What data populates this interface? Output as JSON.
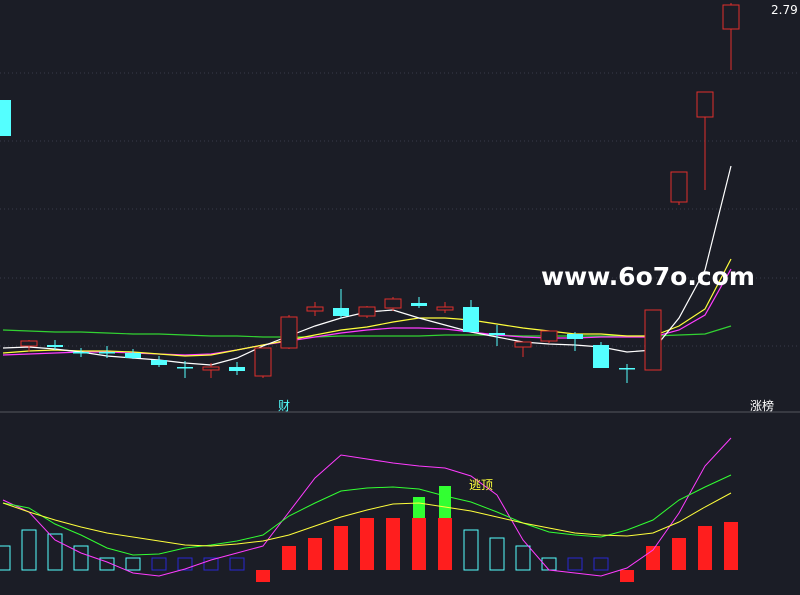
{
  "watermark": "www.6o7o.com",
  "colors": {
    "background": "#1b1d26",
    "grid": "#3a3c4a",
    "up": "#e0302c",
    "down": "#54ffff",
    "ma5": "#ffffff",
    "ma10": "#ffff3c",
    "ma20": "#ff3cff",
    "ma60": "#32d232",
    "bar_red": "#ff1e1e",
    "bar_green": "#32ff32",
    "bar_cyan": "#54ffff",
    "bar_blue": "#2828d2",
    "ind_magenta": "#ff3cff",
    "ind_green": "#32ff32",
    "ind_yellow": "#ffff3c"
  },
  "annotations": {
    "price_max": "2.79",
    "cai_label": "财",
    "zhangting_label": "涨榜",
    "taoding_label": "逃顶"
  },
  "chart_data": {
    "type": "candlestick",
    "candles": [
      {
        "o": 100,
        "h": 100,
        "l": 135,
        "c": 136
      },
      {
        "o": 346,
        "h": 340,
        "l": 352,
        "c": 341
      },
      {
        "o": 345,
        "h": 340,
        "l": 350,
        "c": 347
      },
      {
        "o": 352,
        "h": 348,
        "l": 357,
        "c": 352
      },
      {
        "o": 352,
        "h": 346,
        "l": 358,
        "c": 352
      },
      {
        "o": 353,
        "h": 349,
        "l": 359,
        "c": 358
      },
      {
        "o": 360,
        "h": 356,
        "l": 367,
        "c": 365
      },
      {
        "o": 367,
        "h": 361,
        "l": 378,
        "c": 368
      },
      {
        "o": 370,
        "h": 363,
        "l": 378,
        "c": 367
      },
      {
        "o": 367,
        "h": 362,
        "l": 375,
        "c": 371
      },
      {
        "o": 376,
        "h": 362,
        "l": 378,
        "c": 348
      },
      {
        "o": 348,
        "h": 315,
        "l": 349,
        "c": 317
      },
      {
        "o": 311,
        "h": 302,
        "l": 316,
        "c": 307
      },
      {
        "o": 308,
        "h": 289,
        "l": 318,
        "c": 316
      },
      {
        "o": 316,
        "h": 306,
        "l": 318,
        "c": 307
      },
      {
        "o": 308,
        "h": 297,
        "l": 311,
        "c": 299
      },
      {
        "o": 303,
        "h": 297,
        "l": 308,
        "c": 306
      },
      {
        "o": 310,
        "h": 302,
        "l": 313,
        "c": 307
      },
      {
        "o": 307,
        "h": 300,
        "l": 332,
        "c": 332
      },
      {
        "o": 333,
        "h": 325,
        "l": 346,
        "c": 335
      },
      {
        "o": 347,
        "h": 342,
        "l": 357,
        "c": 342
      },
      {
        "o": 341,
        "h": 331,
        "l": 343,
        "c": 331
      },
      {
        "o": 334,
        "h": 332,
        "l": 351,
        "c": 339
      },
      {
        "o": 345,
        "h": 342,
        "l": 368,
        "c": 368
      },
      {
        "o": 368,
        "h": 364,
        "l": 383,
        "c": 369
      },
      {
        "o": 370,
        "h": 310,
        "l": 370,
        "c": 310
      },
      {
        "o": 202,
        "h": 190,
        "l": 205,
        "c": 172
      },
      {
        "o": 117,
        "h": 92,
        "l": 190,
        "c": 92
      },
      {
        "o": 29,
        "h": 3,
        "l": 70,
        "c": 5
      }
    ],
    "ma5": [
      348,
      347,
      349,
      352,
      356,
      358,
      360,
      363,
      365,
      358,
      346,
      336,
      326,
      318,
      312,
      310,
      318,
      325,
      332,
      337,
      342,
      344,
      345,
      347,
      352,
      350,
      318,
      270,
      166
    ],
    "ma10": [
      353,
      351,
      350,
      351,
      351,
      352,
      354,
      356,
      355,
      350,
      345,
      340,
      335,
      330,
      327,
      322,
      318,
      318,
      320,
      324,
      328,
      331,
      334,
      334,
      336,
      336,
      326,
      309,
      259
    ],
    "ma20": [
      355,
      354,
      353,
      352,
      352,
      353,
      354,
      355,
      354,
      350,
      345,
      341,
      337,
      333,
      330,
      328,
      328,
      329,
      332,
      335,
      337,
      338,
      338,
      337,
      337,
      337,
      330,
      315,
      269
    ],
    "ma60": [
      330,
      331,
      332,
      332,
      333,
      334,
      334,
      335,
      336,
      336,
      337,
      337,
      337,
      336,
      336,
      336,
      336,
      335,
      335,
      335,
      336,
      336,
      336,
      336,
      336,
      336,
      335,
      334,
      326
    ],
    "indicator": {
      "bars": [
        {
          "v": 0,
          "c": "#54ffff",
          "h": 6,
          "hollow": true
        },
        {
          "v": 0,
          "c": "#54ffff",
          "h": 10,
          "hollow": true
        },
        {
          "v": 0,
          "c": "#54ffff",
          "h": 9,
          "hollow": true
        },
        {
          "v": 0,
          "c": "#54ffff",
          "h": 6,
          "hollow": true
        },
        {
          "v": 0,
          "c": "#54ffff",
          "h": 3,
          "hollow": true
        },
        {
          "v": 0,
          "c": "#54ffff",
          "h": 3,
          "hollow": true
        },
        {
          "v": 0,
          "c": "#2828d2",
          "h": 3,
          "hollow": true
        },
        {
          "v": 0,
          "c": "#2828d2",
          "h": 3,
          "hollow": true
        },
        {
          "v": 0,
          "c": "#2828d2",
          "h": 3,
          "hollow": true
        },
        {
          "v": 0,
          "c": "#2828d2",
          "h": 3,
          "hollow": true
        },
        {
          "v": -1,
          "c": "#ff1e1e",
          "h": 6,
          "hollow": false
        },
        {
          "v": 1,
          "c": "#ff1e1e",
          "h": 6,
          "hollow": false
        },
        {
          "v": 1,
          "c": "#ff1e1e",
          "h": 8,
          "hollow": false
        },
        {
          "v": 1,
          "c": "#ff1e1e",
          "h": 11,
          "hollow": false
        },
        {
          "v": 1,
          "c": "#ff1e1e",
          "h": 13,
          "hollow": false
        },
        {
          "v": 1,
          "c": "#ff1e1e",
          "h": 13,
          "hollow": false
        },
        {
          "v": 1,
          "c": "#ff1e1e",
          "h": 13,
          "hollow": false
        },
        {
          "v": 1,
          "c": "#ff1e1e",
          "h": 13,
          "hollow": false
        },
        {
          "v": 0,
          "c": "#54ffff",
          "h": 10,
          "hollow": true
        },
        {
          "v": 0,
          "c": "#54ffff",
          "h": 8,
          "hollow": true
        },
        {
          "v": 0,
          "c": "#54ffff",
          "h": 6,
          "hollow": true
        },
        {
          "v": 0,
          "c": "#54ffff",
          "h": 3,
          "hollow": true
        },
        {
          "v": 0,
          "c": "#2828d2",
          "h": 3,
          "hollow": true
        },
        {
          "v": 0,
          "c": "#2828d2",
          "h": 3,
          "hollow": true
        },
        {
          "v": -1,
          "c": "#ff1e1e",
          "h": 6,
          "hollow": false
        },
        {
          "v": 1,
          "c": "#ff1e1e",
          "h": 6,
          "hollow": false
        },
        {
          "v": 1,
          "c": "#ff1e1e",
          "h": 8,
          "hollow": false
        },
        {
          "v": 1,
          "c": "#ff1e1e",
          "h": 11,
          "hollow": false
        },
        {
          "v": 1,
          "c": "#ff1e1e",
          "h": 12,
          "hollow": false
        }
      ],
      "green_tops": [
        16,
        17
      ],
      "line_magenta": [
        500,
        512,
        540,
        553,
        562,
        573,
        576,
        569,
        560,
        553,
        546,
        512,
        478,
        455,
        459,
        463,
        466,
        468,
        476,
        495,
        540,
        570,
        573,
        576,
        568,
        550,
        513,
        466,
        438
      ],
      "line_green": [
        503,
        508,
        524,
        535,
        548,
        555,
        554,
        548,
        545,
        541,
        535,
        516,
        503,
        491,
        488,
        487,
        489,
        496,
        502,
        512,
        523,
        532,
        535,
        537,
        530,
        520,
        500,
        487,
        475
      ],
      "line_yellow": [
        503,
        512,
        520,
        527,
        533,
        537,
        541,
        545,
        546,
        544,
        541,
        535,
        526,
        517,
        510,
        504,
        503,
        507,
        511,
        517,
        523,
        528,
        533,
        535,
        536,
        533,
        522,
        507,
        493
      ]
    }
  }
}
